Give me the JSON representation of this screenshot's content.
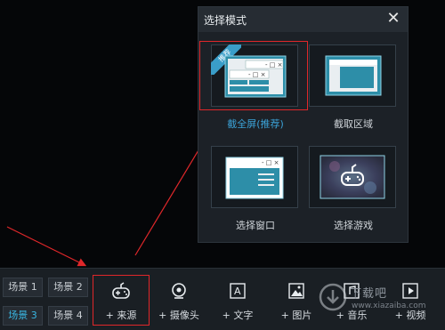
{
  "dialog": {
    "title": "选择模式",
    "options": [
      {
        "label": "截全屏(推荐)",
        "badge": "推荐",
        "active": true
      },
      {
        "label": "截取区域"
      },
      {
        "label": "选择窗口"
      },
      {
        "label": "选择游戏"
      }
    ]
  },
  "scenes": [
    "场景 1",
    "场景 2",
    "场景 3",
    "场景 4"
  ],
  "tools": [
    "+ 来源",
    "+ 摄像头",
    "+ 文字",
    "+ 图片",
    "+ 音乐",
    "+ 视频"
  ],
  "watermark": {
    "name": "下载吧",
    "site": "www.xiazaiba.com"
  },
  "colors": {
    "accent": "#3ba3d8",
    "highlight": "#e0272a",
    "ribbon": "#3a9ec9",
    "window_teal": "#2d8ea8"
  }
}
